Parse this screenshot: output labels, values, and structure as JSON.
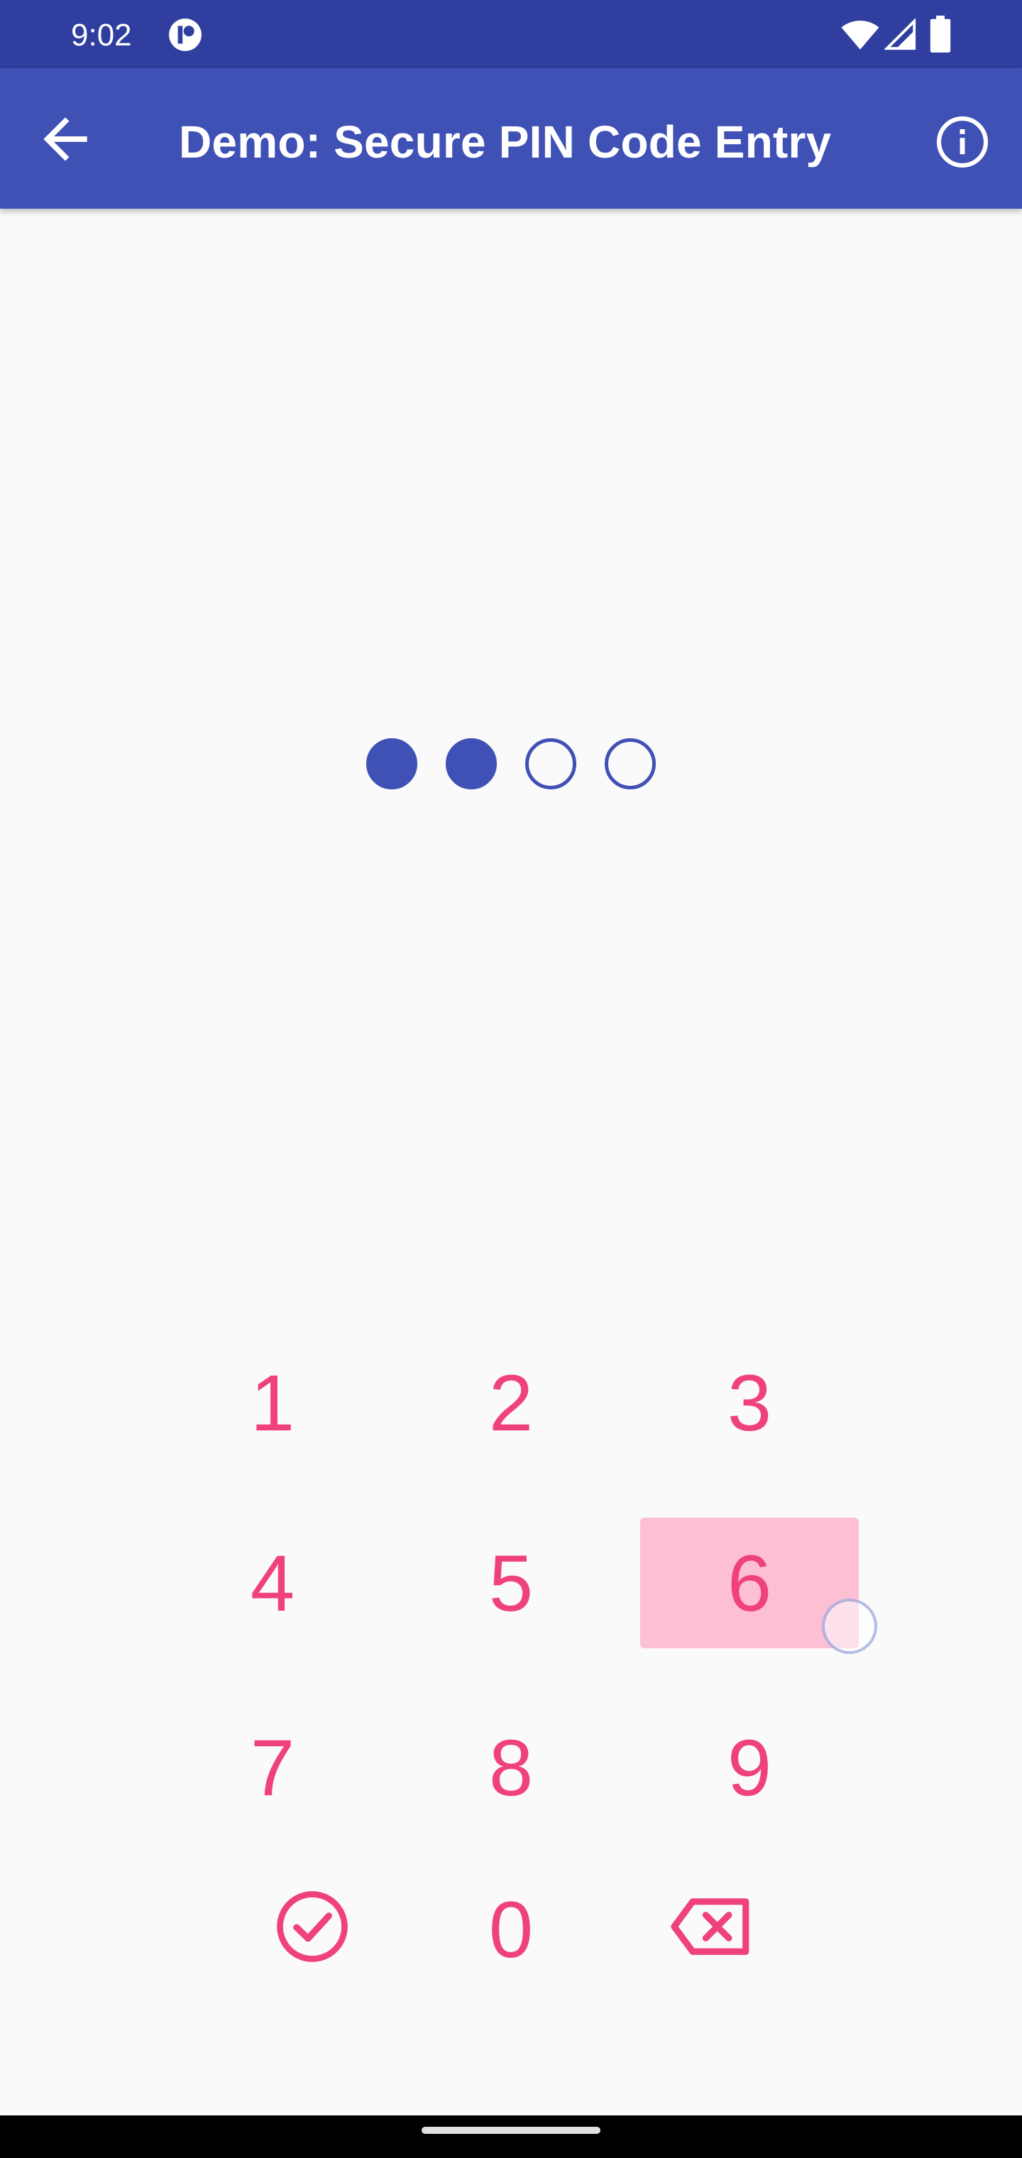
{
  "status_bar": {
    "time": "9:02",
    "icons": [
      "app-notification-icon",
      "wifi-icon",
      "cell-signal-icon",
      "battery-icon"
    ]
  },
  "app_bar": {
    "title": "Demo: Secure PIN Code Entry",
    "back_icon": "arrow-back-icon",
    "info_icon": "info-icon",
    "background": "#3f51b5"
  },
  "pin": {
    "length": 4,
    "entered": 2,
    "dot_color": "#3f51b5"
  },
  "keypad": {
    "accent": "#f0427a",
    "pressed_background": "#fdbfd3",
    "pressed_key": "6",
    "keys": {
      "k1": "1",
      "k2": "2",
      "k3": "3",
      "k4": "4",
      "k5": "5",
      "k6": "6",
      "k7": "7",
      "k8": "8",
      "k9": "9",
      "k0": "0"
    },
    "confirm_icon": "check-circle-icon",
    "backspace_icon": "backspace-icon"
  }
}
